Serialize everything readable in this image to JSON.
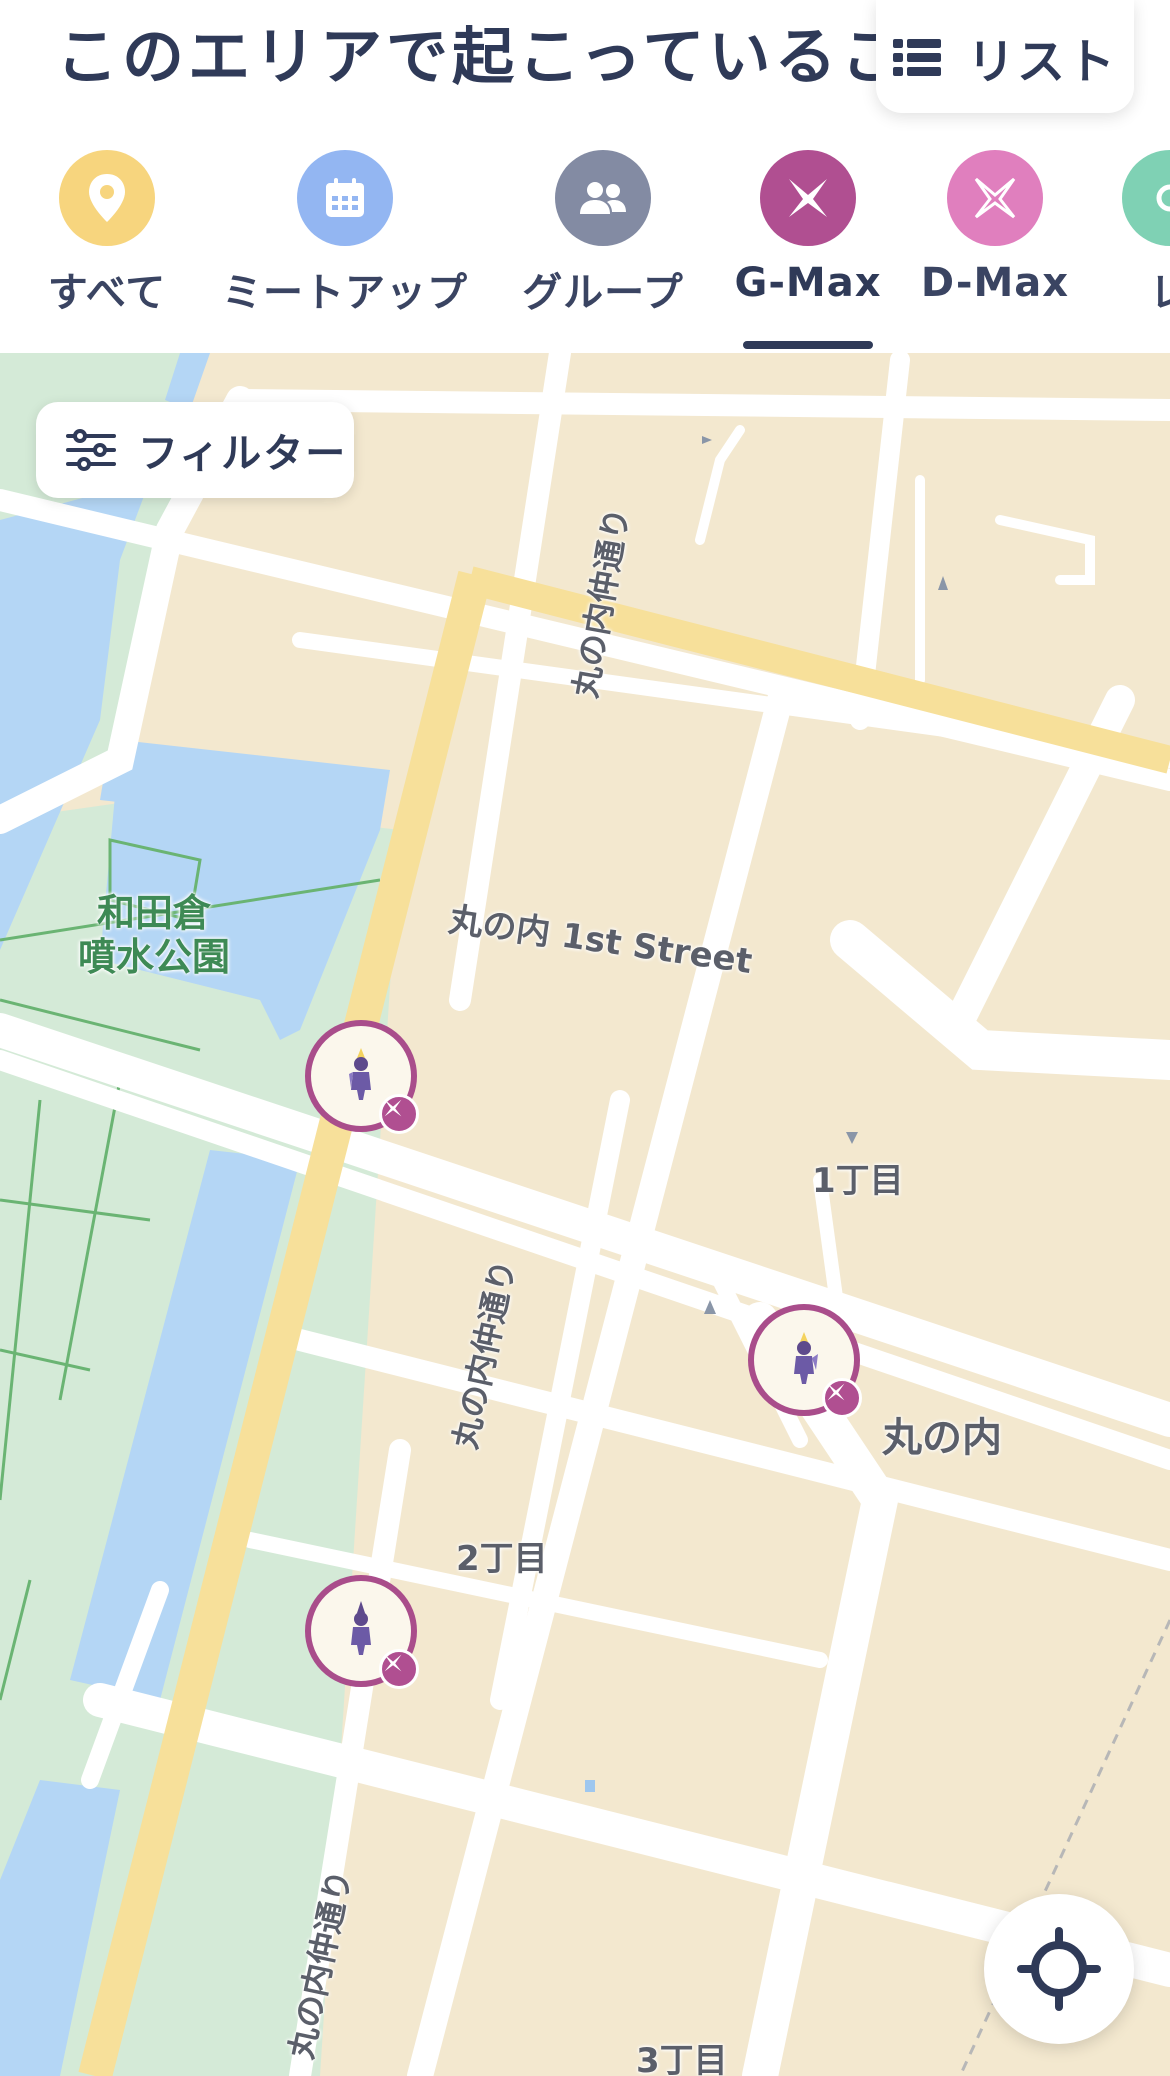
{
  "header": {
    "title": "このエリアで起こっていること",
    "list_button": {
      "label": "リスト",
      "icon": "list-icon"
    }
  },
  "tabs": [
    {
      "label": "すべて",
      "icon": "location-pin-icon",
      "color": "#f7d57e",
      "active": false
    },
    {
      "label": "ミートアップ",
      "icon": "calendar-icon",
      "color": "#93b6f2",
      "active": false
    },
    {
      "label": "グループ",
      "icon": "group-icon",
      "color": "#838ba3",
      "active": false
    },
    {
      "label": "G-Max",
      "icon": "gmax-icon",
      "color": "#b04f91",
      "active": true
    },
    {
      "label": "D-Max",
      "icon": "dmax-icon",
      "color": "#e07fbe",
      "active": false
    },
    {
      "label": "レ",
      "icon": "raid-icon",
      "color": "#7fd1b4",
      "active": false
    }
  ],
  "filter_button": {
    "label": "フィルター",
    "icon": "sliders-icon"
  },
  "map": {
    "labels": {
      "park": "和田倉\n噴水公園",
      "street_1st": "丸の内 1st Street",
      "naka_dori_top": "丸の内仲通り",
      "naka_dori_mid": "丸の内仲通り",
      "naka_dori_bottom": "丸の内仲通り",
      "chome1": "1丁目",
      "chome2": "2丁目",
      "chome3": "3丁目",
      "marunouchi": "丸の内"
    },
    "markers": [
      {
        "name": "gmax-battle-marker"
      },
      {
        "name": "gmax-battle-marker"
      },
      {
        "name": "gmax-battle-marker"
      }
    ]
  },
  "colors": {
    "accent_gmax": "#b04f91",
    "text_dark": "#2f3a58",
    "map_land": "#f3e8cf",
    "map_water": "#b4d6f5",
    "map_park": "#d4ead7",
    "map_major_road": "#f7e09a"
  }
}
